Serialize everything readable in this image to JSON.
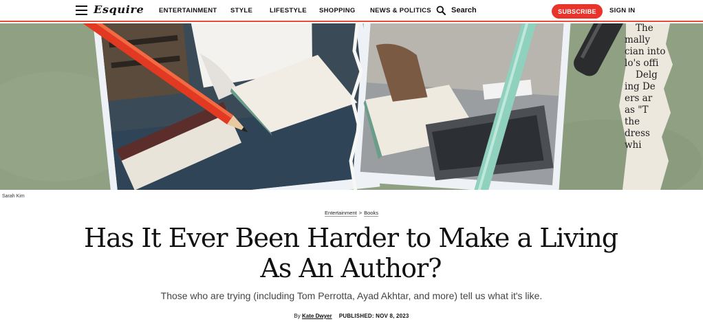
{
  "nav": {
    "logo": "Esquire",
    "links": [
      "ENTERTAINMENT",
      "STYLE",
      "LIFESTYLE",
      "SHOPPING",
      "NEWS & POLITICS"
    ],
    "search_label": "Search",
    "subscribe_label": "SUBSCRIBE",
    "signin_label": "SIGN IN"
  },
  "hero": {
    "caption": "Sarah Kim",
    "clipping_lines": [
      "The",
      "mally",
      "cian into",
      "lo's offi",
      "Delg",
      "ing De",
      "ers ar",
      "as \"T",
      "the",
      "dress",
      "whi"
    ]
  },
  "article": {
    "breadcrumb": [
      "Entertainment",
      "Books"
    ],
    "breadcrumb_sep": ">",
    "headline": "Has It Ever Been Harder to Make a Living As An Author?",
    "dek": "Those who are trying (including Tom Perrotta, Ayad Akhtar, and more) tell us what it's like.",
    "byline_prefix": "By",
    "author": "Kate Dwyer",
    "published": "PUBLISHED: NOV 8, 2023"
  },
  "colors": {
    "accent": "#e8342a",
    "hero_background": "#8fa083"
  }
}
